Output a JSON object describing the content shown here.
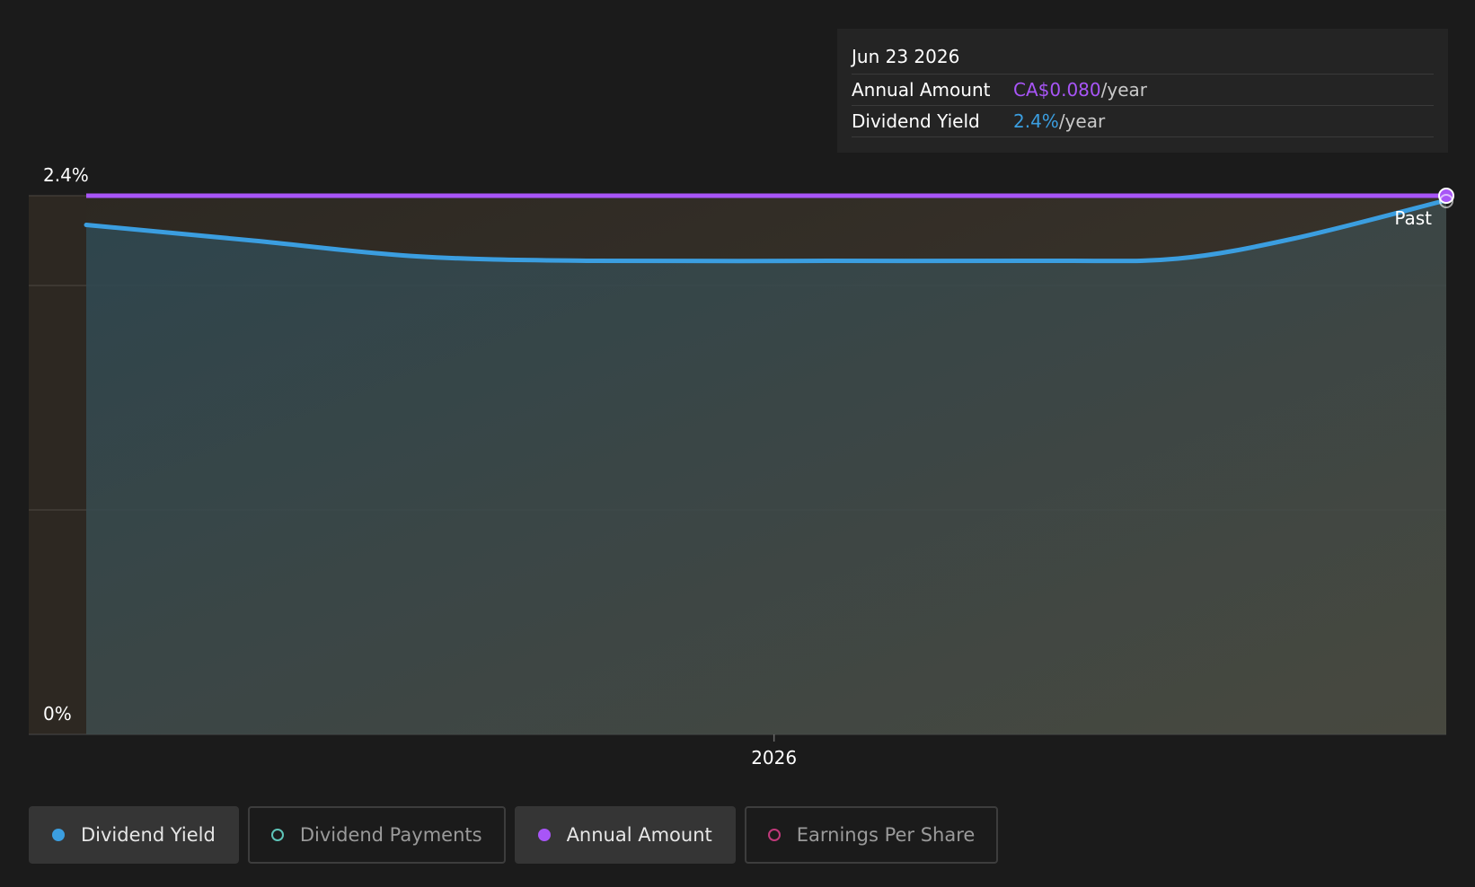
{
  "tooltip": {
    "date": "Jun 23 2026",
    "rows": [
      {
        "label": "Annual Amount",
        "value": "CA$0.080",
        "unit": "/year",
        "color": "#a855f7"
      },
      {
        "label": "Dividend Yield",
        "value": "2.4%",
        "unit": "/year",
        "color": "#3b9ee0"
      }
    ]
  },
  "legend": [
    {
      "label": "Dividend Yield",
      "color": "#3b9ee0",
      "filled": true,
      "active": true
    },
    {
      "label": "Dividend Payments",
      "color": "#5ec4b8",
      "filled": false,
      "active": false
    },
    {
      "label": "Annual Amount",
      "color": "#a855f7",
      "filled": true,
      "active": true
    },
    {
      "label": "Earnings Per Share",
      "color": "#c0397a",
      "filled": false,
      "active": false
    }
  ],
  "chart_data": {
    "type": "line",
    "ylim": [
      0,
      2.4
    ],
    "y_ticks": [
      {
        "value": 2.4,
        "label": "2.4%"
      },
      {
        "value": 0,
        "label": "0%"
      }
    ],
    "x_ticks": [
      {
        "value": "2026-01-01",
        "label": "2026"
      }
    ],
    "xlim": [
      "2025-07-08",
      "2026-06-23"
    ],
    "past_label": "Past",
    "series": [
      {
        "name": "Dividend Yield",
        "color": "#3b9ee0",
        "unit": "%",
        "points": [
          [
            "2025-07-08",
            2.27
          ],
          [
            "2025-08-20",
            2.2
          ],
          [
            "2025-10-01",
            2.13
          ],
          [
            "2025-11-15",
            2.11
          ],
          [
            "2026-01-15",
            2.11
          ],
          [
            "2026-03-15",
            2.11
          ],
          [
            "2026-04-15",
            2.12
          ],
          [
            "2026-05-15",
            2.21
          ],
          [
            "2026-06-23",
            2.38
          ]
        ]
      },
      {
        "name": "Annual Amount",
        "color": "#a855f7",
        "unit": "CA$",
        "points": [
          [
            "2025-07-08",
            2.4
          ],
          [
            "2026-06-23",
            2.4
          ]
        ]
      }
    ]
  }
}
